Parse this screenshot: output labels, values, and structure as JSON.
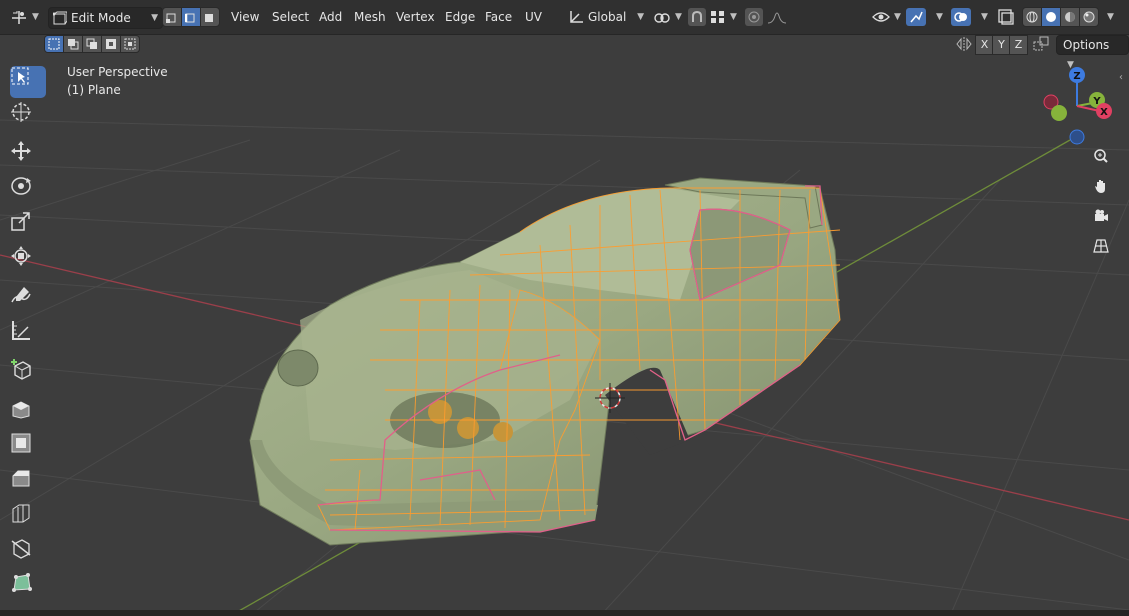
{
  "header": {
    "editor_type_icon": "editor-type-icon",
    "mode_label": "Edit Mode",
    "menus": [
      "View",
      "Select",
      "Add",
      "Mesh",
      "Vertex",
      "Edge",
      "Face",
      "UV"
    ],
    "transform_orientation": "Global",
    "options_label": "Options",
    "axis_x": "X",
    "axis_y": "Y",
    "axis_z": "Z"
  },
  "viewport": {
    "view_name": "User Perspective",
    "object_name": "(1) Plane"
  },
  "gizmo": {
    "axes": [
      "X",
      "Y",
      "Z"
    ],
    "colors": {
      "x": "#e04062",
      "y": "#86b33b",
      "z": "#3d7be0"
    }
  },
  "colors": {
    "accent": "#4772b3",
    "mesh": "#9aa882",
    "wire": "#ff9d2e",
    "seam": "#e0608a"
  },
  "toolbar": {
    "tools": [
      "select-box-icon",
      "cursor-icon",
      "move-icon",
      "rotate-icon",
      "scale-icon",
      "transform-icon",
      "annotate-icon",
      "measure-icon",
      "add-cube-icon",
      "extrude-icon",
      "inset-icon",
      "bevel-icon",
      "loop-cut-icon",
      "knife-icon",
      "poly-build-icon"
    ]
  }
}
